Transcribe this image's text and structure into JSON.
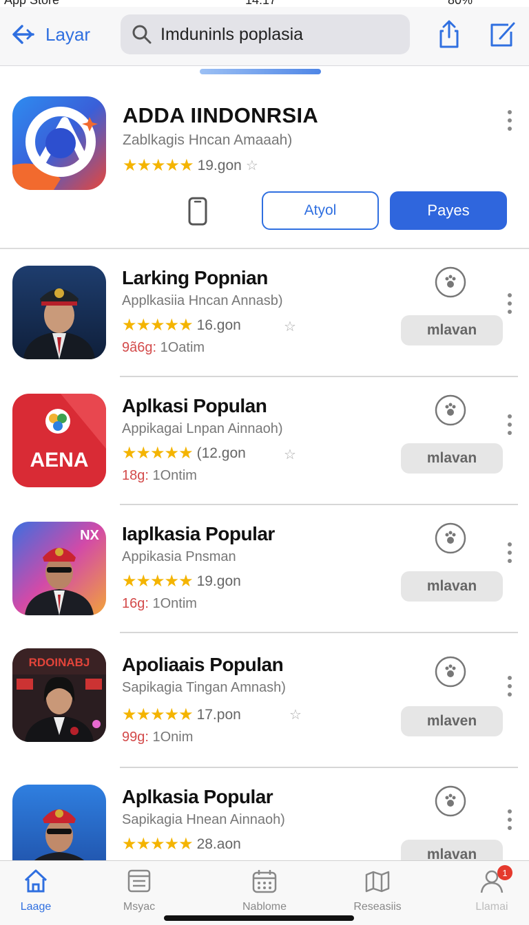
{
  "status_bar": {
    "carrier": "App Store",
    "time": "14:17",
    "battery": "80%"
  },
  "header": {
    "back_label": "Layar",
    "search_value": "Imduninls poplasia"
  },
  "featured": {
    "title": "ADDA IINDONRSIA",
    "subtitle": "Zablkagis Hncan Amaaah)",
    "stars": "★★★★★",
    "rating_text": "19.gon",
    "secondary_button": "Atyol",
    "primary_button": "Payes"
  },
  "apps": [
    {
      "title": "Larking Popnian",
      "subtitle": "Applkasiia Hncan Annasb)",
      "stars": "★★★★★",
      "rating_text": "16.gon",
      "meta_accent": "9ã6g:",
      "meta_text": "1Oatim",
      "button": "mlavan"
    },
    {
      "title": "Aplkasi Populan",
      "subtitle": "Appikagai Lnpan Ainnaoh)",
      "stars": "★★★★★",
      "rating_text": "(12.gon",
      "meta_accent": "18g:",
      "meta_text": "1Ontim",
      "button": "mlavan",
      "icon_text": "AENA"
    },
    {
      "title": "Iaplkasia Popular",
      "subtitle": "Appikasia Pnsman",
      "stars": "★★★★★",
      "rating_text": "19.gon",
      "meta_accent": "16g:",
      "meta_text": "1Ontim",
      "button": "mlavan",
      "icon_text": "NX"
    },
    {
      "title": "Apoliaais Populan",
      "subtitle": "Sapikagia Tingan Amnash)",
      "stars": "★★★★★",
      "rating_text": "17.pon",
      "meta_accent": "99g:",
      "meta_text": "1Onim",
      "button": "mlaven",
      "icon_text": "RDOINABJ"
    },
    {
      "title": "Aplkasia Popular",
      "subtitle": "Sapikagia Hnean Ainnaoh)",
      "stars": "★★★★★",
      "rating_text": "28.aon",
      "meta_accent": "",
      "meta_text": "",
      "button": "mlavan"
    }
  ],
  "tabs": [
    {
      "label": "Laage",
      "icon": "house-icon",
      "active": true
    },
    {
      "label": "Msyac",
      "icon": "list-icon"
    },
    {
      "label": "Nablome",
      "icon": "calendar-icon"
    },
    {
      "label": "Reseasiis",
      "icon": "map-icon"
    },
    {
      "label": "Llamai",
      "icon": "profile-icon",
      "badge": "1"
    }
  ],
  "colors": {
    "accent": "#2f6fe0",
    "primary_button": "#2f66dd",
    "star": "#f4b400",
    "meta_red": "#d34a4a",
    "badge": "#e5392d"
  }
}
